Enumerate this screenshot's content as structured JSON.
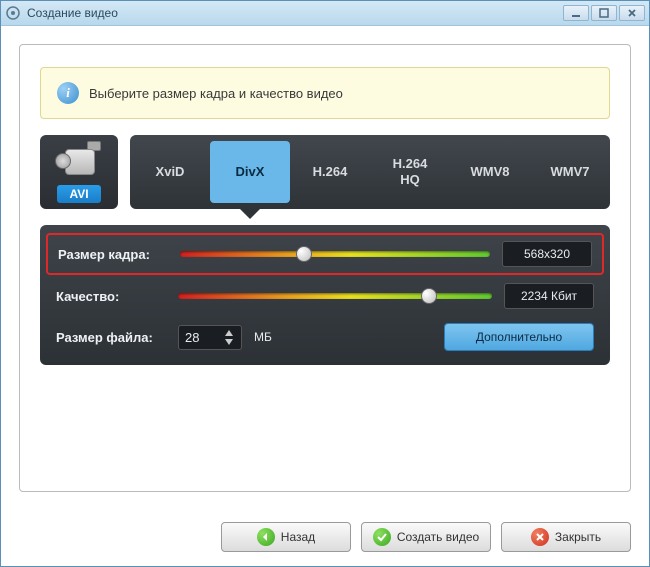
{
  "window": {
    "title": "Создание видео"
  },
  "info": {
    "text": "Выберите размер кадра и качество видео"
  },
  "format": {
    "label": "AVI"
  },
  "codecs": {
    "items": [
      "XviD",
      "DivX",
      "H.264",
      "H.264\nHQ",
      "WMV8",
      "WMV7"
    ],
    "active_index": 1
  },
  "settings": {
    "frame": {
      "label": "Размер кадра:",
      "value": "568x320",
      "pos": 40
    },
    "quality": {
      "label": "Качество:",
      "value": "2234 Кбит",
      "pos": 80
    },
    "filesize": {
      "label": "Размер файла:",
      "value": "28",
      "unit": "МБ"
    },
    "adv": "Дополнительно"
  },
  "buttons": {
    "back": "Назад",
    "create": "Создать видео",
    "close": "Закрыть"
  }
}
